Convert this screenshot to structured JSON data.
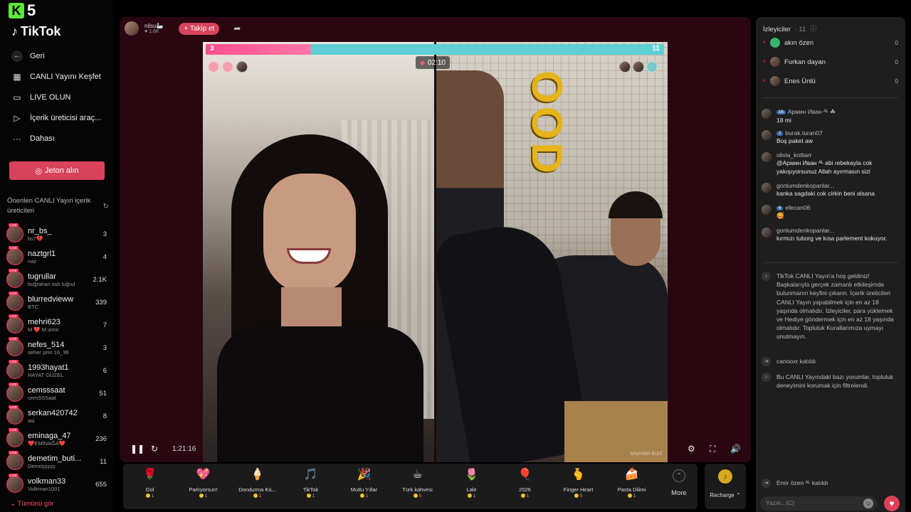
{
  "brand": {
    "k_logo": "K",
    "k_number": "5",
    "tiktok": "TikTok"
  },
  "nav": {
    "back": "Geri",
    "discover": "CANLI Yayını Keşfet",
    "go_live": "LIVE OLUN",
    "creator_tools": "İçerik üreticisi araç...",
    "more": "Dahası",
    "coins": "Jeton alın"
  },
  "suggested": {
    "title": "Önerilen CANLI Yayın içerik üreticileri",
    "see_all": "Tümünü gör",
    "items": [
      {
        "name": "nr_bs_",
        "sub": "bs7💔",
        "count": "3"
      },
      {
        "name": "naztgrl1",
        "sub": "naz",
        "count": "4"
      },
      {
        "name": "tugrullar",
        "sub": "buğrahan aslı tuğrul",
        "count": "2.1K"
      },
      {
        "name": "blurredvieww",
        "sub": "BTC",
        "count": "339"
      },
      {
        "name": "mehri623",
        "sub": "M ❤️ M izmir",
        "count": "7"
      },
      {
        "name": "nefes_514",
        "sub": "seher şirin 16_36",
        "count": "3"
      },
      {
        "name": "1993hayat1",
        "sub": "HAYAT GÜZEL",
        "count": "6"
      },
      {
        "name": "cemsssaat",
        "sub": "cemSSSaat",
        "count": "51"
      },
      {
        "name": "serkan420742",
        "sub": "asi",
        "count": "8"
      },
      {
        "name": "eminaga_47",
        "sub": "❤️EMİNAĞA❤️",
        "count": "236"
      },
      {
        "name": "demetim_buti...",
        "sub": "Demoşşşşş",
        "count": "11"
      },
      {
        "name": "volkman33",
        "sub": "Volkman1001",
        "count": "655"
      }
    ]
  },
  "host": {
    "name": "nilsu🦢",
    "likes": "♥ 1.6K",
    "follow": "+ Takip et"
  },
  "battle": {
    "left_score": "3",
    "right_score": "11",
    "left_share": 0.23,
    "timer": "02:10",
    "watermark": "soymen kızıl"
  },
  "player": {
    "elapsed": "1:21:16"
  },
  "gifts": [
    {
      "name": "Gül",
      "price": "1",
      "icon": "rose",
      "emoji": "🌹"
    },
    {
      "name": "Parlıyorsun!",
      "price": "1",
      "icon": "heart-gift",
      "emoji": "💖"
    },
    {
      "name": "Dondurma Kü...",
      "price": "1",
      "icon": "ice-cream",
      "emoji": "🍦"
    },
    {
      "name": "TikTok",
      "price": "1",
      "icon": "tiktok-gift",
      "emoji": "🎵"
    },
    {
      "name": "Mutlu Yıllar",
      "price": "1",
      "icon": "new-year",
      "emoji": "🎉"
    },
    {
      "name": "Türk kahvesi",
      "price": "5",
      "icon": "coffee",
      "emoji": "☕"
    },
    {
      "name": "Lale",
      "price": "1",
      "icon": "tulip",
      "emoji": "🌷"
    },
    {
      "name": "2026",
      "price": "1",
      "icon": "year-2026",
      "emoji": "🎈"
    },
    {
      "name": "Finger Heart",
      "price": "5",
      "icon": "finger-heart",
      "emoji": "🫰"
    },
    {
      "name": "Pasta Dilimi",
      "price": "1",
      "icon": "cake",
      "emoji": "🍰"
    }
  ],
  "gift_more": "More",
  "recharge": "Recharge ⌃",
  "viewers": {
    "title": "İzleyiciler",
    "count": "· 11",
    "items": [
      {
        "name": "akın özen",
        "score": "0"
      },
      {
        "name": "Furkan dayan",
        "score": "0"
      },
      {
        "name": "Enes Ünlü",
        "score": "0"
      }
    ]
  },
  "chat": [
    {
      "user": "Армин Иван ᴬᴸ ☘",
      "level": "16",
      "text": "18 mi"
    },
    {
      "user": "burak.turan07",
      "level": "7",
      "text": "Boş paket aw"
    },
    {
      "user": "olivia_kotliarr",
      "level": "",
      "text": "@Армин Иван ᴬᴸ abi rebekayla cok yakışıyorsunuz Allah ayırmasın sizi"
    },
    {
      "user": "gonlumdenkopanlar...",
      "level": "",
      "text": "kanka sagdaki cok cirkin beni alsana"
    },
    {
      "user": "efecan06",
      "level": "6",
      "text": "🥰"
    },
    {
      "user": "gonlumdenkopanlar...",
      "level": "",
      "text": "kırmızı tuborg ve kısa parlement kokuyor."
    }
  ],
  "system": {
    "welcome": "TikTok CANLI Yayın'a hoş geldiniz! Başkalarıyla gerçek zamanlı etkileşimde bulunmanın keyfini çıkarın. İçerik üreticileri CANLI Yayın yapabilmek için en az 18 yaşında olmalıdır. İzleyiciler, para yüklemek ve Hediye göndermek için en az 18 yaşında olmalıdır. Topluluk Kurallarımıza uymayı unutmayın.",
    "joined1": "canooxr katıldı",
    "filter": "Bu CANLI Yayındaki bazı yorumlar, topluluk deneyimini korumak için filtrelendi.",
    "joined2": "Emir özen ᴬᴸ katıldı"
  },
  "chat_input": {
    "placeholder": "Yazın...(C)"
  },
  "colors": {
    "accent": "#d8425a",
    "battle_left": "#ff4d8d",
    "battle_right": "#5fd0d6",
    "stage_bg": "#2a0611"
  }
}
